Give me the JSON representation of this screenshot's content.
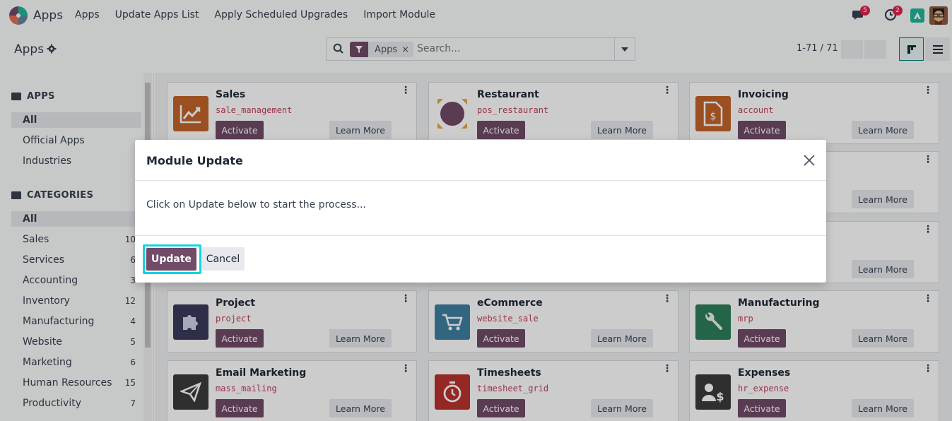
{
  "navbar": {
    "brand": "Apps",
    "menu": [
      "Apps",
      "Update Apps List",
      "Apply Scheduled Upgrades",
      "Import Module"
    ],
    "messages_count": "5",
    "activities_count": "2"
  },
  "control_panel": {
    "title": "Apps",
    "search": {
      "facet": "Apps",
      "placeholder": "Search..."
    },
    "pager": "1-71 / 71"
  },
  "sidebar": {
    "apps_header": "APPS",
    "apps_items": [
      {
        "label": "All",
        "active": true
      },
      {
        "label": "Official Apps"
      },
      {
        "label": "Industries"
      }
    ],
    "categories_header": "CATEGORIES",
    "categories": [
      {
        "label": "All",
        "count": "",
        "active": true
      },
      {
        "label": "Sales",
        "count": "10"
      },
      {
        "label": "Services",
        "count": "6"
      },
      {
        "label": "Accounting",
        "count": "3"
      },
      {
        "label": "Inventory",
        "count": "12"
      },
      {
        "label": "Manufacturing",
        "count": "4"
      },
      {
        "label": "Website",
        "count": "5"
      },
      {
        "label": "Marketing",
        "count": "6"
      },
      {
        "label": "Human Resources",
        "count": "15"
      },
      {
        "label": "Productivity",
        "count": "7"
      }
    ]
  },
  "apps": [
    {
      "name": "Sales",
      "technical": "sale_management",
      "icon": "chart-line-icon",
      "color": "#c2652a"
    },
    {
      "name": "Restaurant",
      "technical": "pos_restaurant",
      "icon": "restaurant-icon",
      "color": "#ffffff"
    },
    {
      "name": "Invoicing",
      "technical": "account",
      "icon": "invoice-icon",
      "color": "#c2652a"
    },
    {
      "name": "Project",
      "technical": "project",
      "icon": "puzzle-icon",
      "color": "#3a3a5a"
    },
    {
      "name": "eCommerce",
      "technical": "website_sale",
      "icon": "cart-icon",
      "color": "#3f7fa0"
    },
    {
      "name": "Manufacturing",
      "technical": "mrp",
      "icon": "wrench-icon",
      "color": "#2e7d5b"
    },
    {
      "name": "Email Marketing",
      "technical": "mass_mailing",
      "icon": "paper-plane-icon",
      "color": "#3b3b3b"
    },
    {
      "name": "Timesheets",
      "technical": "timesheet_grid",
      "icon": "stopwatch-icon",
      "color": "#b8332e"
    },
    {
      "name": "Expenses",
      "technical": "hr_expense",
      "icon": "user-dollar-icon",
      "color": "#3b3b3b"
    }
  ],
  "card_buttons": {
    "activate": "Activate",
    "learn_more": "Learn More"
  },
  "modal": {
    "title": "Module Update",
    "body": "Click on Update below to start the process...",
    "update_label": "Update",
    "cancel_label": "Cancel"
  },
  "colors": {
    "primary": "#714b67",
    "highlight": "#17d3e0",
    "badge": "#e0234f"
  }
}
